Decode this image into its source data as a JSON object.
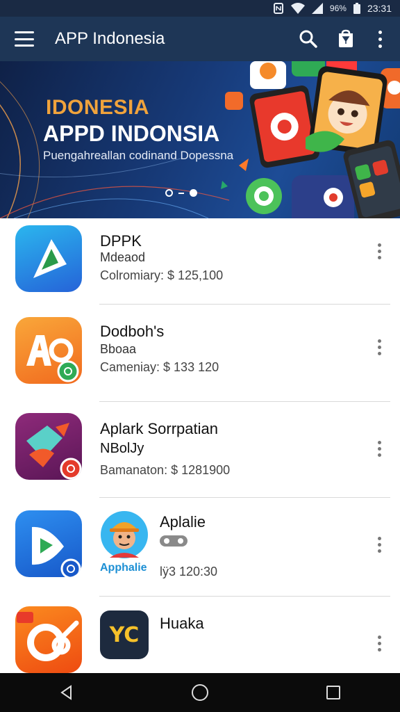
{
  "status_bar": {
    "battery": "96%",
    "time": "23:31"
  },
  "app_bar": {
    "title": "APP Indonesia",
    "icons": [
      "menu-icon",
      "search-icon",
      "store-icon",
      "more-vert-icon"
    ]
  },
  "banner": {
    "eyebrow": "IDONESIA",
    "title": "APPD INDONSIA",
    "subtitle": "Puengahreallan codinand Dopessna",
    "page_count": 2,
    "active_page": 2
  },
  "apps": [
    {
      "name": "DPPK",
      "subtitle": "Mdeaod",
      "meta": "Colromiary: $ 125,100",
      "icon": "play-triangle-icon",
      "colors": [
        "#2bb6ee",
        "#2563d8"
      ]
    },
    {
      "name": "Dodboh's",
      "subtitle": "Bboaa",
      "meta": "Cameniay: $ 133 120",
      "icon": "ao-letters-icon",
      "colors": [
        "#f9a73a",
        "#f16a1e"
      ]
    },
    {
      "name": "Aplark Sorrpatian",
      "subtitle": "NBolJy",
      "meta": "Bamanaton: $ 1281900",
      "icon": "tag-bird-icon",
      "colors": [
        "#8e2a7a",
        "#5a1656"
      ]
    },
    {
      "name": "Aplalie",
      "avatar_caption": "Apphalie",
      "meta": "lÿ3 120:30",
      "icon": "play-arrow-icon",
      "colors": [
        "#2e8ff0",
        "#1758c9"
      ]
    },
    {
      "name": "Huaka",
      "icon": "co-swirl-icon",
      "logo_text": "YC",
      "colors": [
        "#fb8a1f",
        "#ee4b11"
      ]
    }
  ],
  "nav_bar": {
    "icons": [
      "back-icon",
      "home-icon",
      "recents-icon"
    ]
  }
}
